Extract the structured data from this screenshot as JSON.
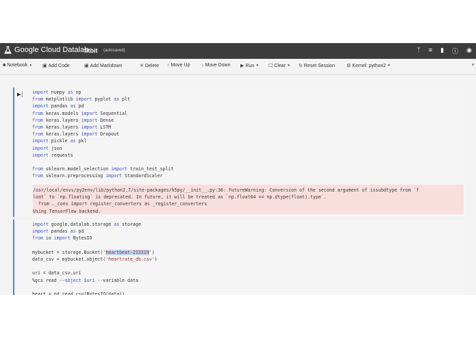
{
  "header": {
    "app_title": "Google Cloud Datalab",
    "notebook_name": "fitbit",
    "autosave_status": "(autosaved)",
    "icons": [
      "branch-icon",
      "list-icon",
      "bookmark-icon",
      "help-icon",
      "account-icon"
    ]
  },
  "toolbar": {
    "notebook_label": "Notebook",
    "add_code_label": "Add Code",
    "add_markdown_label": "Add Markdown",
    "delete_label": "Delete",
    "move_up_label": "Move Up",
    "move_down_label": "Move Down",
    "run_label": "Run",
    "clear_label": "Clear",
    "reset_session_label": "Reset Session",
    "kernel_label": "Kernel: python2"
  },
  "cells": [
    {
      "code_lines": [
        "import numpy as np",
        "from matplotlib import pyplot as plt",
        "import pandas as pd",
        "from keras.models import Sequential",
        "from keras.layers import Dense",
        "from keras.layers import LSTM",
        "from keras.layers import Dropout",
        "import pickle as pkl",
        "import json",
        "import requests",
        "",
        "from sklearn.model_selection import train_test_split",
        "from sklearn.preprocessing import StandardScaler"
      ],
      "output_lines": [
        "/usr/local/envs/py2env/lib/python2.7/site-packages/h5py/__init__.py:36: FutureWarning: Conversion of the second argument of issubdtype from `f",
        "loat` to `np.floating` is deprecated. In future, it will be treated as `np.float64 == np.dtype(float).type`.",
        "  from ._conv import register_converters as _register_converters",
        "Using TensorFlow backend."
      ]
    },
    {
      "code_lines": [
        "import google.datalab.storage as storage",
        "import pandas as pd",
        "from io import BytesIO",
        "",
        "mybucket = storage.Bucket('heartbeat-233319')",
        "data_csv = mybucket.object('heartrate_db.csv')",
        "",
        "uri = data_csv.uri",
        "%gcs read --object $uri --variable data",
        "",
        "heart = pd.read_csv(BytesIO(data))"
      ]
    }
  ],
  "colors": {
    "topbar_bg": "#3c3c3c",
    "cell_selected_bar": "#3e8ed6",
    "stderr_bg": "#f9dede",
    "keyword": "#3a54c0",
    "string": "#9c2a2a"
  }
}
